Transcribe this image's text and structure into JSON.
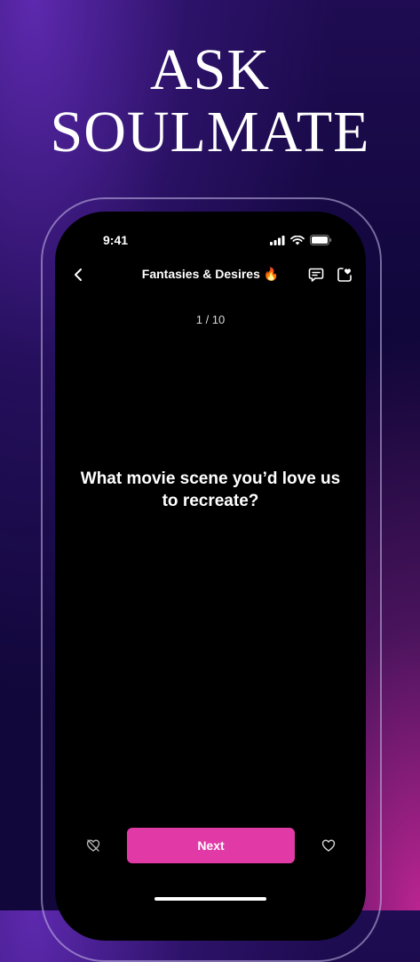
{
  "headline": {
    "line1": "ASK",
    "line2": "SOULMATE"
  },
  "status_bar": {
    "time": "9:41",
    "icons": [
      "signal-icon",
      "wifi-icon",
      "battery-icon"
    ]
  },
  "nav": {
    "title": "Fantasies & Desires",
    "title_emoji": "🔥",
    "back_icon": "chevron-left-icon",
    "chat_icon": "chat-icon",
    "save_icon": "heart-square-icon"
  },
  "progress": {
    "counter": "1 / 10"
  },
  "question": {
    "text": "What movie scene you’d love us to recreate?"
  },
  "actions": {
    "next_label": "Next",
    "dislike_icon": "heart-off-icon",
    "like_icon": "heart-icon"
  },
  "colors": {
    "accent": "#e13aa6",
    "screen_bg": "#000000",
    "background_top": "#1f0c52",
    "background_glow": "#c42696"
  }
}
